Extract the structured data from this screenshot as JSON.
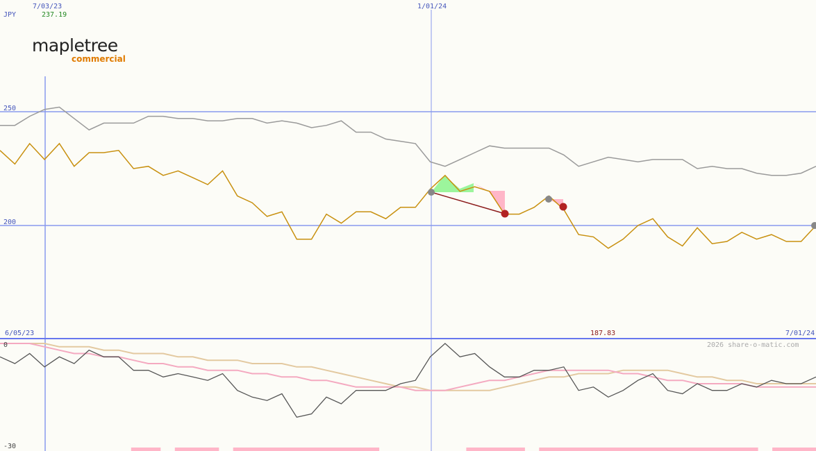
{
  "header": {
    "currency": "JPY",
    "top_date": "7/03/23",
    "top_price": "237.19",
    "cursor_date": "1/01/24"
  },
  "logo": {
    "name": "mapletree",
    "subtitle": "commercial"
  },
  "lower_panel": {
    "start_date": "6/05/23",
    "end_date": "7/01/24",
    "mid_value": "187.83",
    "copyright": "2026 share-o-matic.com",
    "y_top_label": "0",
    "y_bottom_label": "-30"
  },
  "colors": {
    "price": "#c8900f",
    "index": "#9a9a9a",
    "grid": "#8899ee",
    "gain": "#9cf59c",
    "loss": "#ffb6c8",
    "trade_line": "#8b1a1a",
    "osc_dark": "#555555",
    "osc_pink": "#f4a9c0",
    "osc_tan": "#e3c9a0"
  },
  "chart_data": {
    "type": "line",
    "y_ticks": [
      200,
      250
    ],
    "ylim": [
      152,
      299
    ],
    "series": [
      {
        "values": [
          233,
          227,
          236,
          229,
          236,
          226,
          232,
          232,
          233,
          225,
          226,
          222,
          224,
          221,
          218,
          224,
          213,
          210,
          204,
          206,
          194,
          194,
          205,
          201,
          206,
          206,
          203,
          208,
          208,
          216,
          222,
          215,
          217,
          215,
          205,
          205,
          208,
          213,
          207,
          196,
          195,
          190,
          194,
          200,
          203,
          195,
          191,
          199,
          192,
          193,
          197,
          194,
          196,
          193,
          193,
          200
        ]
      },
      {
        "values": [
          244,
          244,
          248,
          251,
          252,
          247,
          242,
          245,
          245,
          245,
          248,
          248,
          247,
          247,
          246,
          246,
          247,
          247,
          245,
          246,
          245,
          243,
          244,
          246,
          241,
          241,
          238,
          237,
          236,
          228,
          226,
          229,
          232,
          235,
          234,
          234,
          234,
          234,
          231,
          226,
          228,
          230,
          229,
          228,
          229,
          229,
          229,
          225,
          226,
          225,
          225,
          223,
          222,
          222,
          223,
          226
        ]
      }
    ],
    "oscillator": {
      "ylim": [
        -30,
        0
      ],
      "series": [
        {
          "values": [
            -4,
            -6,
            -3,
            -7,
            -4,
            -6,
            -2,
            -4,
            -4,
            -8,
            -8,
            -10,
            -9,
            -10,
            -11,
            -9,
            -14,
            -16,
            -17,
            -15,
            -22,
            -21,
            -16,
            -18,
            -14,
            -14,
            -14,
            -12,
            -11,
            -4,
            0,
            -4,
            -3,
            -7,
            -10,
            -10,
            -8,
            -8,
            -7,
            -14,
            -13,
            -16,
            -14,
            -11,
            -9,
            -14,
            -15,
            -12,
            -14,
            -14,
            -12,
            -13,
            -11,
            -12,
            -12,
            -10
          ]
        },
        {
          "values": [
            0,
            0,
            0,
            -1,
            -2,
            -3,
            -3,
            -4,
            -4,
            -5,
            -6,
            -6,
            -7,
            -7,
            -8,
            -8,
            -8,
            -9,
            -9,
            -10,
            -10,
            -11,
            -11,
            -12,
            -13,
            -13,
            -13,
            -13,
            -14,
            -14,
            -14,
            -13,
            -12,
            -11,
            -11,
            -10,
            -9,
            -8,
            -8,
            -8,
            -8,
            -8,
            -9,
            -9,
            -10,
            -11,
            -11,
            -12,
            -12,
            -12,
            -12,
            -13,
            -13,
            -13,
            -13,
            -13
          ]
        },
        {
          "values": [
            0,
            0,
            0,
            0,
            -1,
            -1,
            -1,
            -2,
            -2,
            -3,
            -3,
            -3,
            -4,
            -4,
            -5,
            -5,
            -5,
            -6,
            -6,
            -6,
            -7,
            -7,
            -8,
            -9,
            -10,
            -11,
            -12,
            -13,
            -13,
            -14,
            -14,
            -14,
            -14,
            -14,
            -13,
            -12,
            -11,
            -10,
            -10,
            -9,
            -9,
            -9,
            -8,
            -8,
            -8,
            -8,
            -9,
            -10,
            -10,
            -11,
            -11,
            -12,
            -12,
            -12,
            -12,
            -12
          ]
        }
      ],
      "bars": [
        0,
        0,
        0,
        0,
        0,
        0,
        0,
        0,
        0,
        1,
        1,
        0,
        1,
        1,
        1,
        0,
        1,
        1,
        1,
        1,
        1,
        1,
        1,
        1,
        1,
        1,
        0,
        0,
        0,
        0,
        0,
        0,
        1,
        1,
        1,
        1,
        0,
        1,
        1,
        1,
        1,
        1,
        1,
        1,
        1,
        1,
        1,
        1,
        1,
        1,
        1,
        1,
        0,
        1,
        1,
        1
      ]
    }
  }
}
